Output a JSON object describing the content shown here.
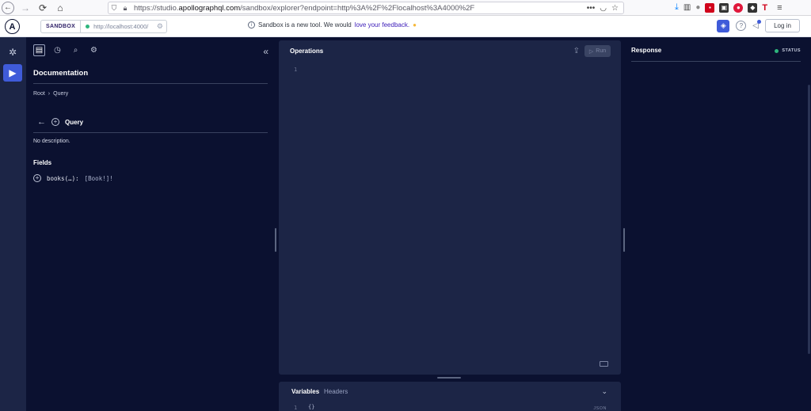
{
  "browser": {
    "url_prefix": "https://studio.",
    "url_host": "apollographql.com",
    "url_rest": "/sandbox/explorer?endpoint=http%3A%2F%2Flocalhost%3A4000%2F",
    "more_actions": "•••"
  },
  "header": {
    "logo": "A",
    "sandbox_tag": "SANDBOX",
    "endpoint": "http://localhost:4000/",
    "notice_text": "Sandbox is a new tool. We would ",
    "notice_link": "love your feedback.",
    "login_label": "Log in"
  },
  "docs": {
    "title": "Documentation",
    "breadcrumb_root": "Root",
    "breadcrumb_sep": "›",
    "breadcrumb_current": "Query",
    "type_name": "Query",
    "description": "No description.",
    "fields_heading": "Fields",
    "fields": [
      {
        "name": "books(…):",
        "type": "[Book!]!"
      }
    ]
  },
  "operations": {
    "title": "Operations",
    "run_label": "Run",
    "line_number": "1"
  },
  "variables": {
    "tab_variables": "Variables",
    "tab_headers": "Headers",
    "line_number": "1",
    "content": "{}",
    "format_label": "JSON"
  },
  "response": {
    "title": "Response",
    "status_label": "STATUS"
  },
  "colors": {
    "accent": "#3f5bd9",
    "status_ok": "#2eb67d",
    "background": "#0b1130",
    "panel": "#1c2546"
  }
}
